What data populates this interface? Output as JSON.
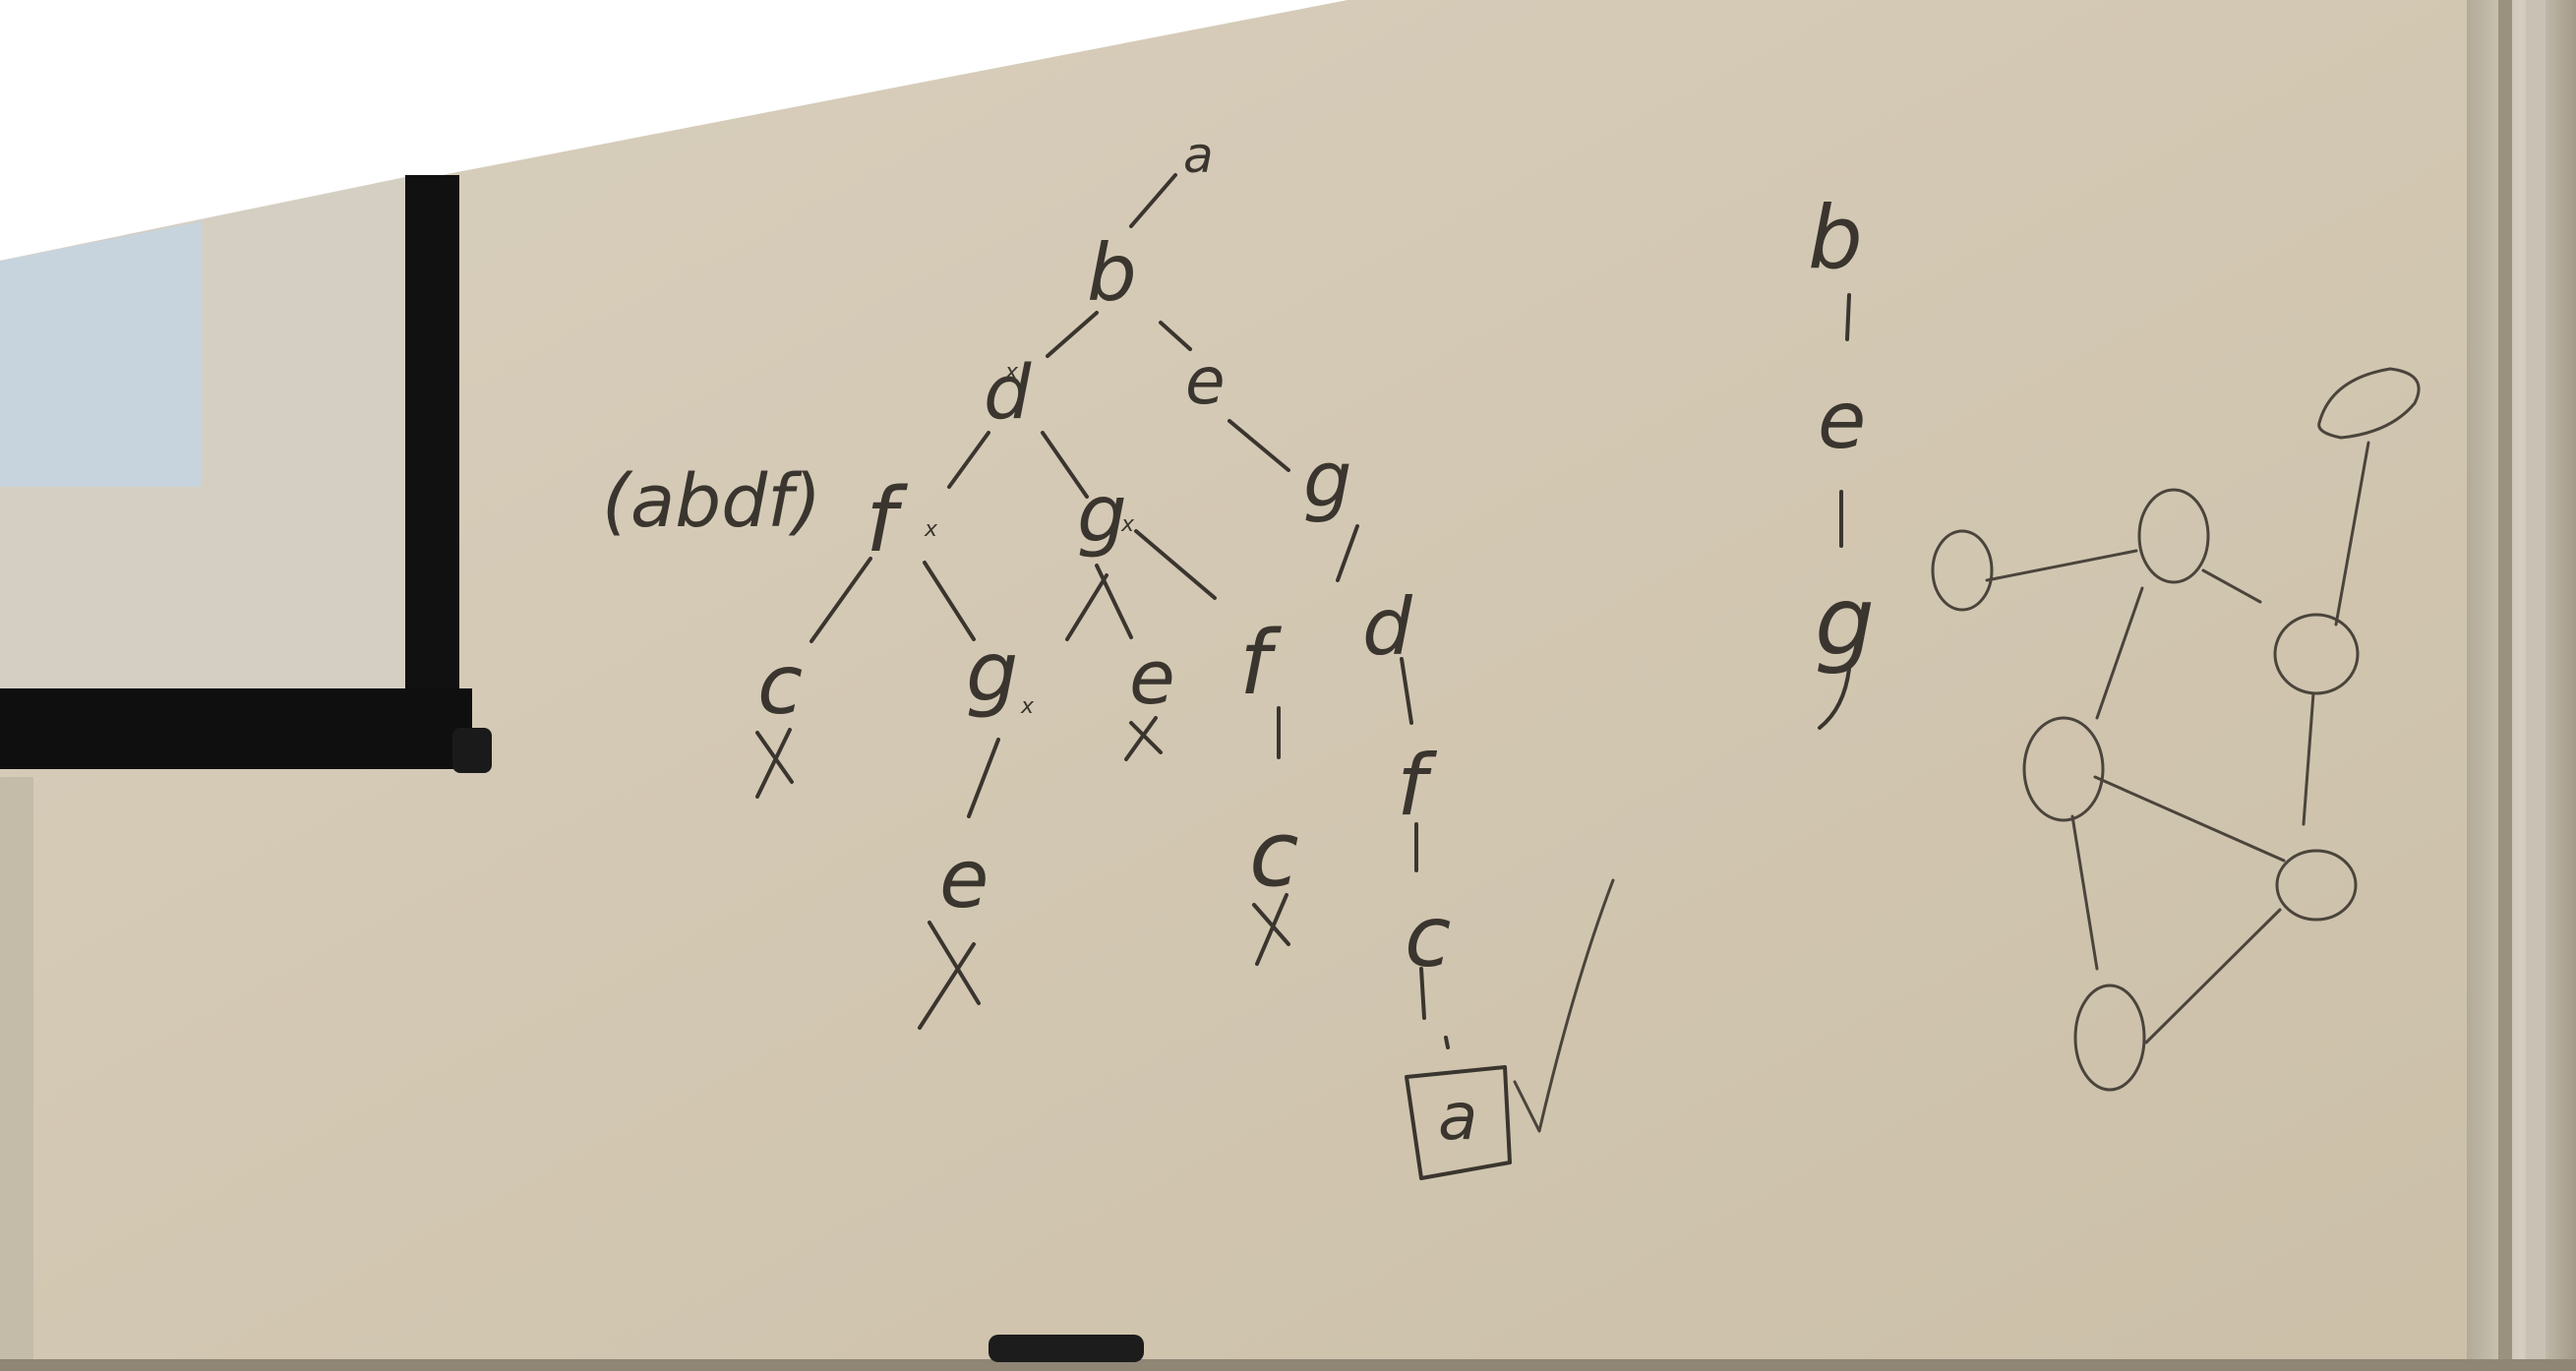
{
  "search_tree": {
    "root": "a",
    "nodes": [
      "b",
      "d",
      "e",
      "f",
      "g",
      "g",
      "c",
      "g",
      "e",
      "f",
      "d",
      "e",
      "c",
      "f",
      "c",
      "a"
    ],
    "side_note": "(abdf)",
    "leaf_marks": [
      "x",
      "x",
      "x",
      "x"
    ]
  },
  "path_list": [
    "b",
    "e",
    "g"
  ]
}
